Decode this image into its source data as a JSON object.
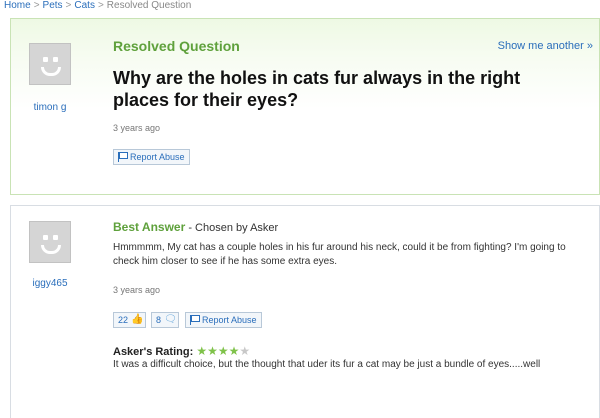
{
  "breadcrumb": {
    "home": "Home",
    "pets": "Pets",
    "cats": "Cats",
    "current": "Resolved Question",
    "separator": ">"
  },
  "question": {
    "section_title": "Resolved Question",
    "show_another": "Show me another »",
    "title": "Why are the holes in cats fur always in the right places for their eyes?",
    "asker": "timon g",
    "time_ago": "3 years ago",
    "report_abuse": "Report Abuse"
  },
  "answer": {
    "label": "Best Answer",
    "chosen_by": "- Chosen by Asker",
    "user": "iggy465",
    "text": "Hmmmmm, My cat has a couple holes in his fur around his neck, could it be from fighting? I'm going to check him closer to see if he has some extra eyes.",
    "time_ago": "3 years ago",
    "thumbs_up_count": "22",
    "thumbs_down_count": "8",
    "report_abuse": "Report Abuse",
    "rating_label": "Asker's Rating:",
    "rating_value": 4,
    "rating_max": 5,
    "rating_comment": "It was a difficult choice, but the thought that uder its fur a cat may be just a bundle of eyes.....well"
  },
  "colors": {
    "accent_green": "#5fa13c",
    "link_blue": "#2a6ebb",
    "star_green": "#7fc24a"
  },
  "icons": [
    "avatar",
    "flag-icon",
    "thumbs-up-icon",
    "comment-icon",
    "star-icon"
  ]
}
